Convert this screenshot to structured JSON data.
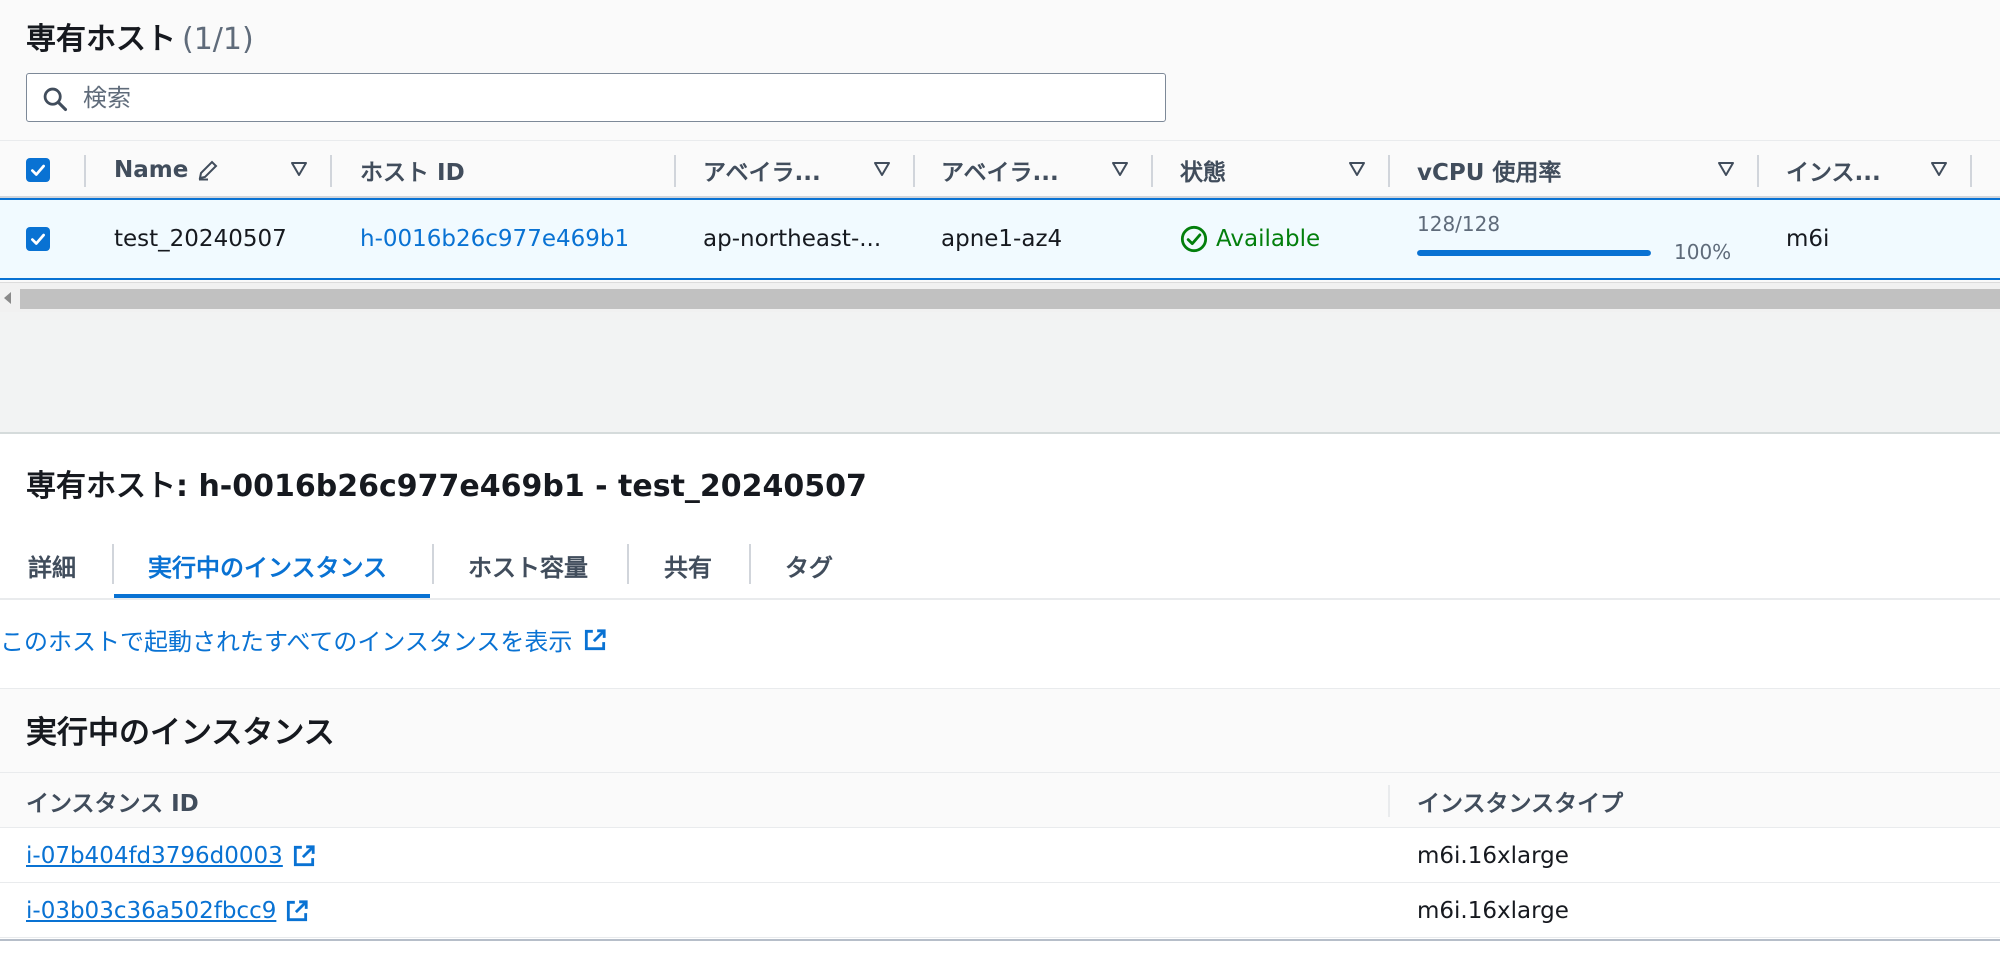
{
  "hosts_panel": {
    "title": "専有ホスト",
    "count": "(1/1)",
    "search_placeholder": "検索",
    "columns": {
      "name": "Name",
      "host_id": "ホスト ID",
      "az1": "アベイラ...",
      "az2": "アベイラ...",
      "state": "状態",
      "vcpu": "vCPU 使用率",
      "instance": "インス..."
    },
    "row": {
      "name": "test_20240507",
      "host_id": "h-0016b26c977e469b1",
      "region": "ap-northeast-...",
      "az_id": "apne1-az4",
      "state": "Available",
      "vcpu_text": "128/128",
      "vcpu_fraction": 1.0,
      "vcpu_pct": "100%",
      "instance_family": "m6i"
    }
  },
  "details": {
    "title": "専有ホスト: h-0016b26c977e469b1 - test_20240507",
    "tabs": [
      "詳細",
      "実行中のインスタンス",
      "ホスト容量",
      "共有",
      "タグ"
    ],
    "active_tab": "実行中のインスタンス",
    "view_all_link": "このホストで起動されたすべてのインスタンスを表示"
  },
  "running_instances": {
    "title": "実行中のインスタンス",
    "columns": [
      "インスタンス ID",
      "インスタンスタイプ"
    ],
    "rows": [
      {
        "id": "i-07b404fd3796d0003",
        "type": "m6i.16xlarge"
      },
      {
        "id": "i-03b03c36a502fbcc9",
        "type": "m6i.16xlarge"
      }
    ]
  },
  "colors": {
    "accent": "#0972d3",
    "success": "#037f0c",
    "text": "#16191f",
    "muted": "#5f6b7a"
  },
  "icons": [
    "search-icon",
    "checkbox-checked-icon",
    "edit-pencil-icon",
    "sort-caret-icon",
    "status-available-icon",
    "external-link-icon"
  ]
}
